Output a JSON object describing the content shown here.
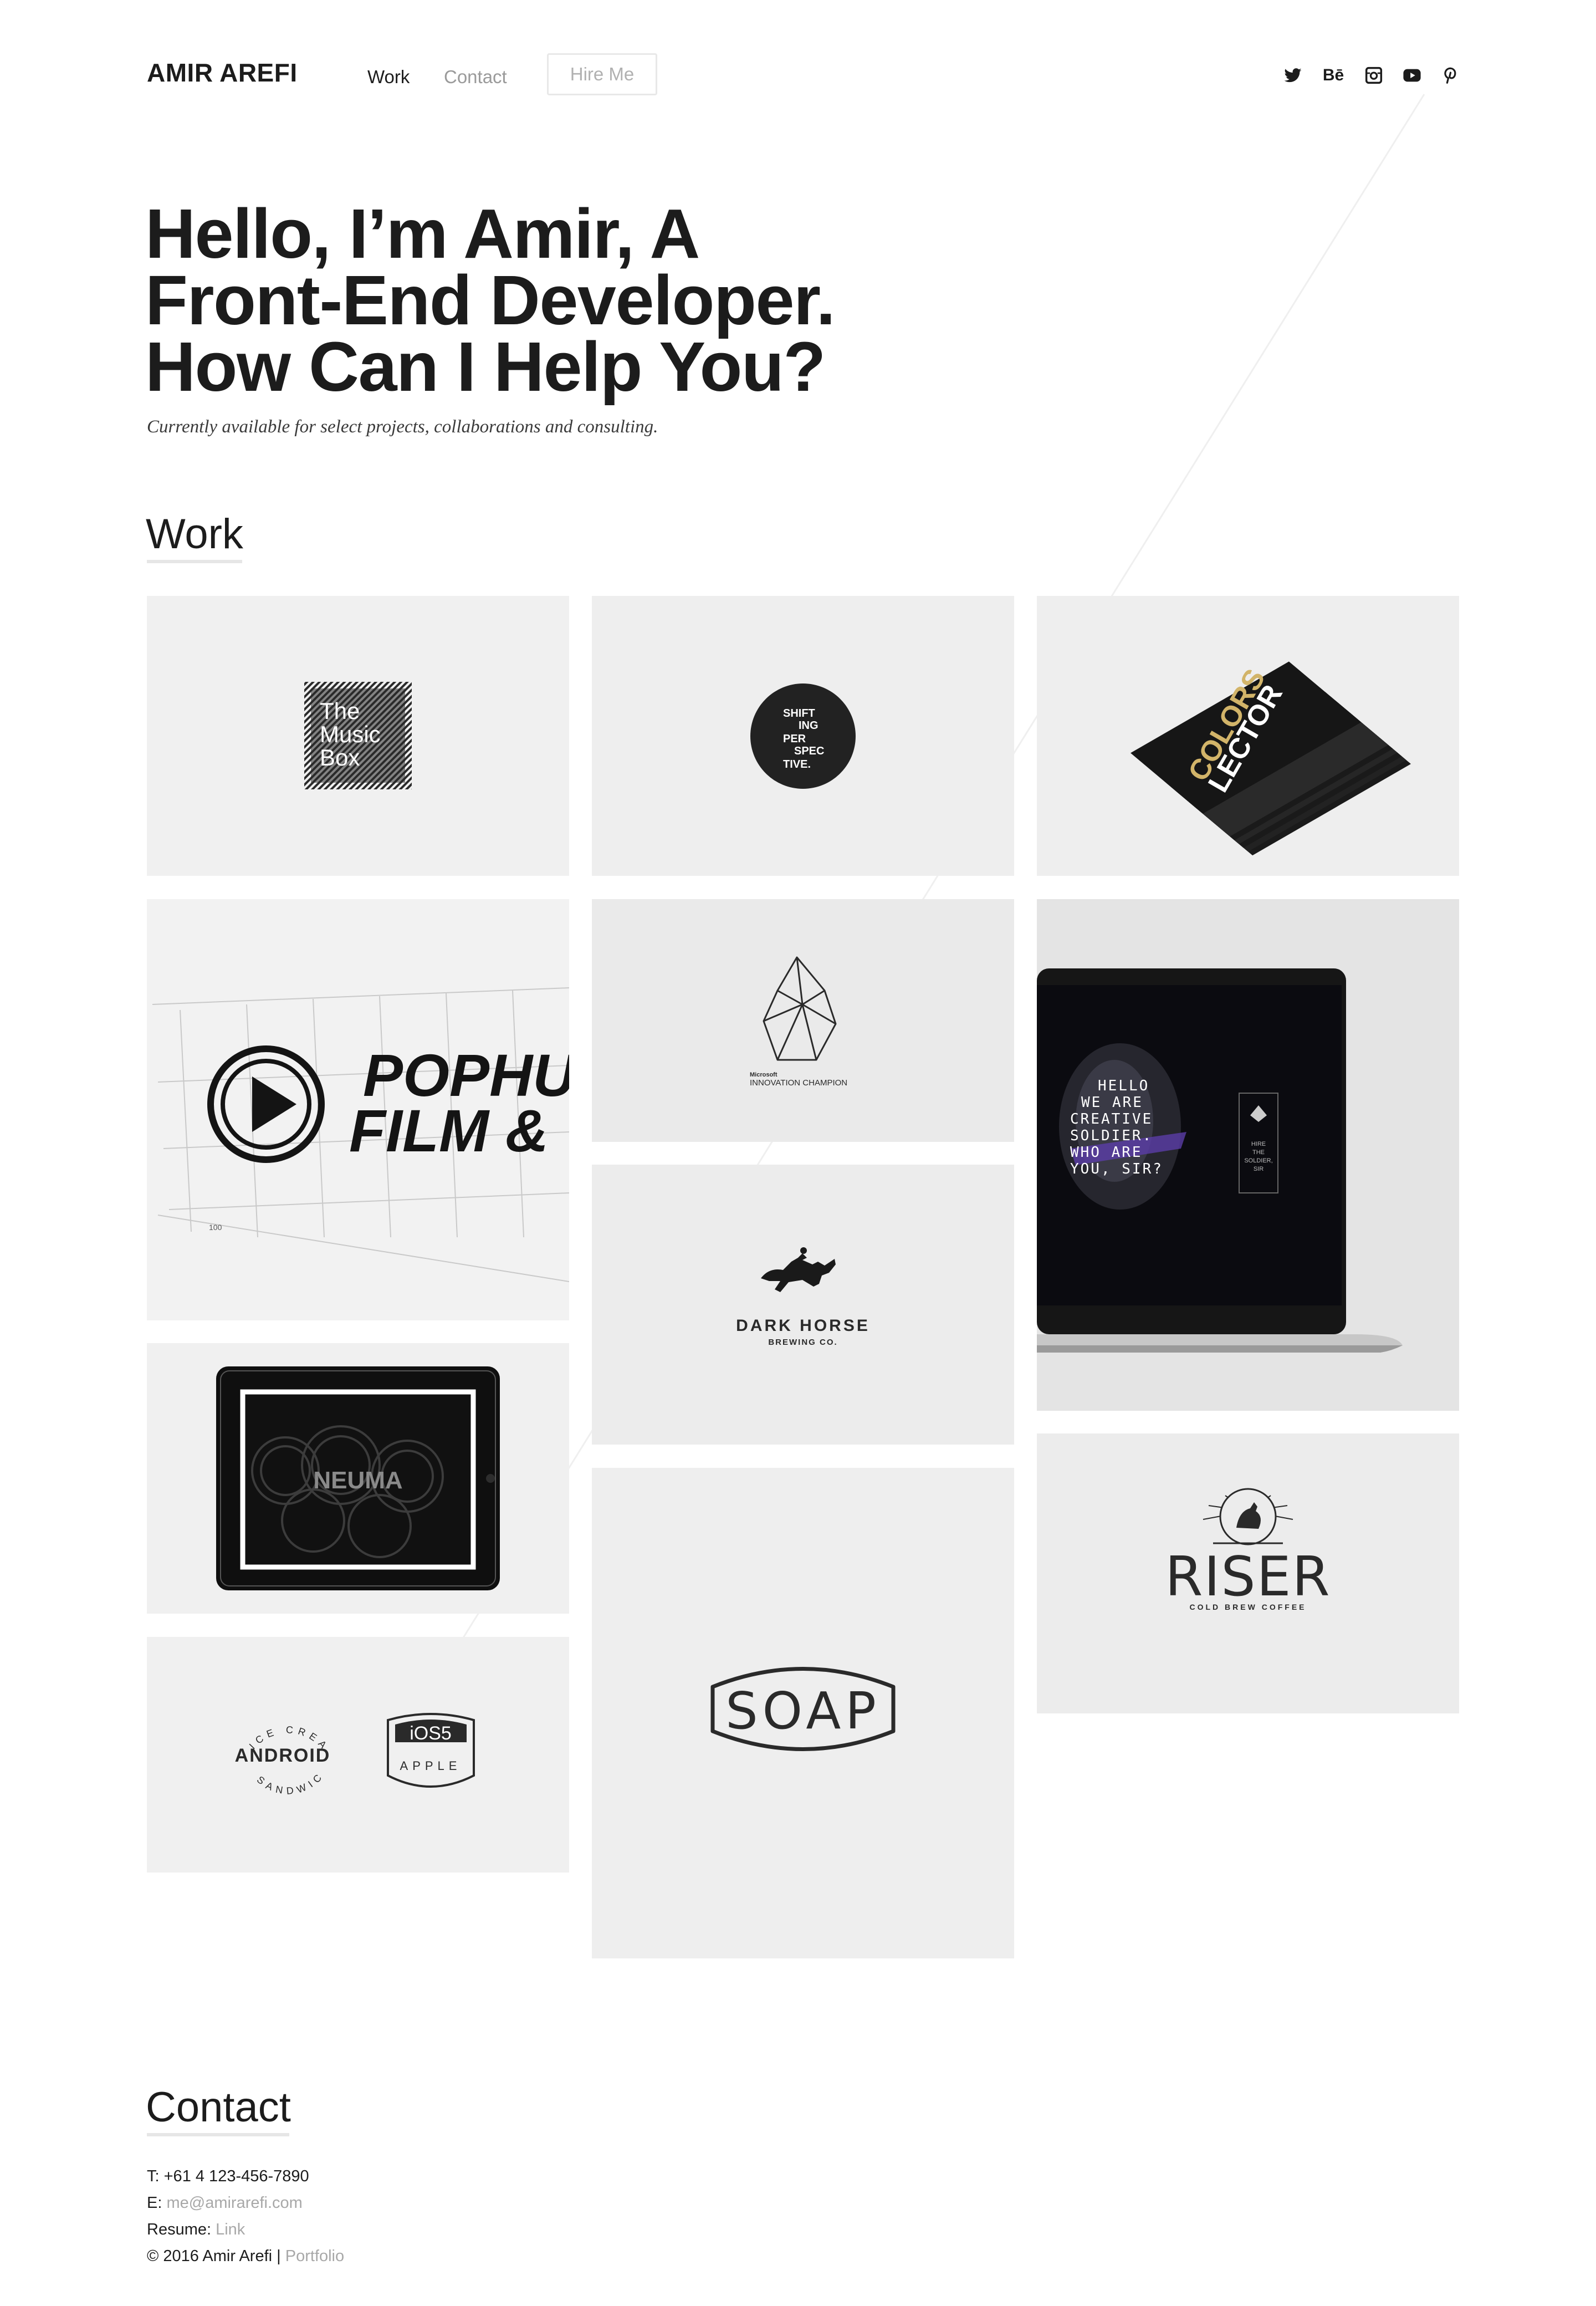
{
  "header": {
    "logo": "AMIR AREFI",
    "nav": {
      "work": "Work",
      "contact": "Contact"
    },
    "hire_button": "Hire Me",
    "social": {
      "behance": "Bē"
    }
  },
  "hero": {
    "lines": [
      "Hello, I’m Amir, A",
      "Front-End Developer.",
      "How Can I Help You?"
    ],
    "subtitle": "Currently available for select projects, collaborations and consulting."
  },
  "work": {
    "title": "Work",
    "music_box": [
      "The",
      "Music",
      "Box"
    ],
    "shifting": [
      "SHIFT",
      "ING",
      "PER",
      "SPEC",
      "TIVE."
    ],
    "colors_lector": [
      "COLORS",
      "LECTOR"
    ],
    "pophu": [
      "POPHU",
      "FILM &",
      "100"
    ],
    "innovation": [
      "Microsoft",
      "INNOVATION CHAMPION"
    ],
    "dark_horse": [
      "DARK HORSE",
      "BREWING CO."
    ],
    "laptop_text": [
      "HELLO",
      "WE ARE",
      "CREATIVE",
      "SOLDIER.",
      "WHO ARE",
      "YOU, SIR?"
    ],
    "laptop_side": [
      "HIRE",
      "THE",
      "SOLDIER,",
      "SIR"
    ],
    "neuma": "NEUMA",
    "soap": "SOAP",
    "riser": [
      "RISER",
      "COLD BREW COFFEE"
    ],
    "android": [
      "ICE CREAM",
      "ANDROID",
      "SANDWICH"
    ],
    "ios": [
      "iOS5",
      "APPLE"
    ]
  },
  "contact": {
    "title": "Contact",
    "phone_label": "T: ",
    "phone": "+61 4 123-456-7890",
    "email_label": "E: ",
    "email": "me@amirarefi.com",
    "resume_label": "Resume: ",
    "resume_link": "Link",
    "copyright": "© 2016 Amir Arefi | ",
    "portfolio_link": "Portfolio"
  },
  "colors": {
    "text": "#1c1c1c",
    "muted": "#9a9a9a",
    "tile": "#f0f0f0"
  }
}
